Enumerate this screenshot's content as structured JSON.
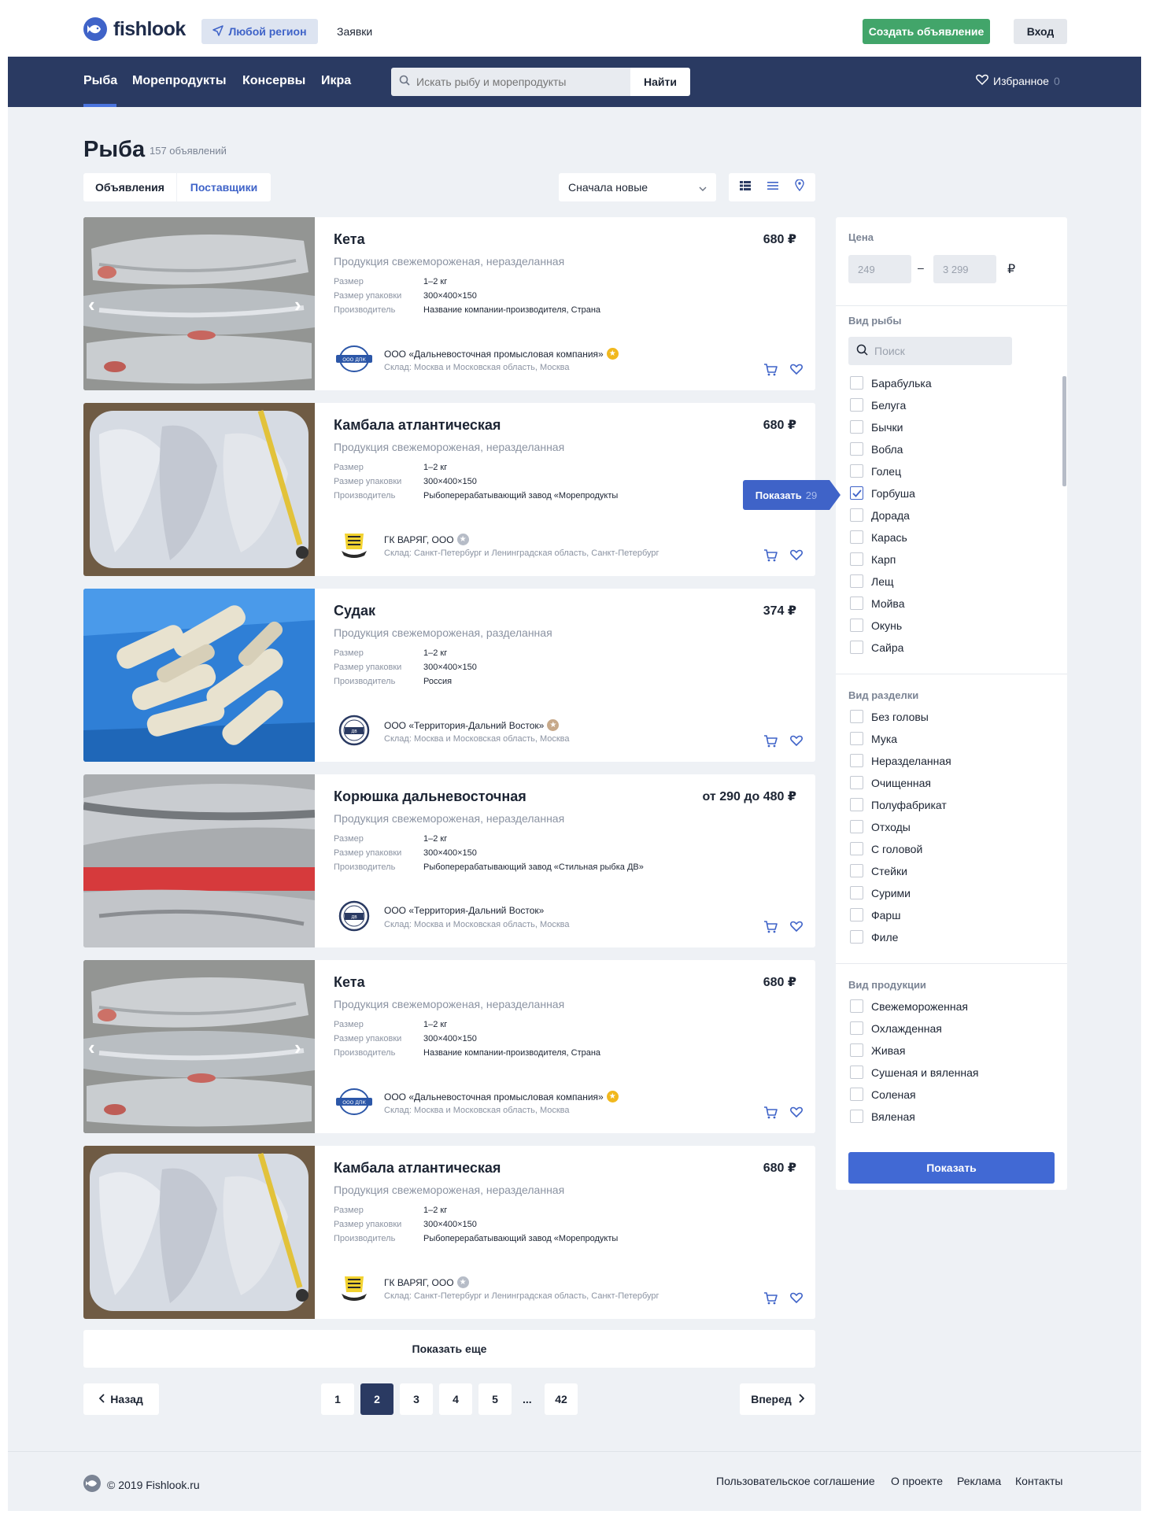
{
  "header": {
    "logo_text": "fishlook",
    "region_label": "Любой регион",
    "requests_label": "Заявки",
    "create_label": "Создать объявление",
    "login_label": "Вход"
  },
  "nav": {
    "items": [
      "Рыба",
      "Морепродукты",
      "Консервы",
      "Икра"
    ],
    "search_placeholder": "Искать рыбу и морепродукты",
    "search_button": "Найти",
    "favorites_label": "Избранное",
    "favorites_count": "0"
  },
  "main": {
    "title": "Рыба",
    "count": "157 объявлений",
    "tabs": [
      "Объявления",
      "Поставщики"
    ],
    "sort_label": "Сначала новые",
    "spec_labels": [
      "Размер",
      "Размер упаковки",
      "Производитель"
    ],
    "listings": [
      {
        "title": "Кета",
        "price": "680 ₽",
        "sub": "Продукция свежемороженая, неразделанная",
        "size": "1–2 кг",
        "pack": "300×400×150",
        "maker": "Название компании-производителя, Страна",
        "seller": "ООО «Дальневосточная промысловая компания»",
        "warehouse": "Склад: Москва и Московская область, Москва",
        "star": "gold",
        "image": "keta",
        "seller_logo": "dpk"
      },
      {
        "title": "Камбала атлантическая",
        "price": "680 ₽",
        "sub": "Продукция свежемороженая, неразделанная",
        "size": "1–2 кг",
        "pack": "300×400×150",
        "maker": "Рыбоперерабатывающий завод «Морепродукты",
        "seller": "ГК ВАРЯГ, ООО",
        "warehouse": "Склад: Санкт-Петербург и Ленинградская область, Санкт-Петербург",
        "star": "grey",
        "image": "kambala",
        "seller_logo": "varyag"
      },
      {
        "title": "Судак",
        "price": "374 ₽",
        "sub": "Продукция свежемороженая, разделанная",
        "size": "1–2 кг",
        "pack": "300×400×150",
        "maker": "Россия",
        "seller": "ООО «Территория-Дальний Восток»",
        "warehouse": "Склад: Москва и Московская область, Москва",
        "star": "grey-dark",
        "image": "sudak",
        "seller_logo": "dv"
      },
      {
        "title": "Корюшка дальневосточная",
        "price": "от 290 до 480 ₽",
        "sub": "Продукция свежемороженая, неразделанная",
        "size": "1–2 кг",
        "pack": "300×400×150",
        "maker": "Рыбоперерабатывающий завод «Стильная рыбка ДВ»",
        "seller": "ООО «Территория-Дальний Восток»",
        "warehouse": "Склад: Москва и Московская область, Москва",
        "star": "none",
        "image": "koryushka",
        "seller_logo": "dv"
      },
      {
        "title": "Кета",
        "price": "680 ₽",
        "sub": "Продукция свежемороженая, неразделанная",
        "size": "1–2 кг",
        "pack": "300×400×150",
        "maker": "Название компании-производителя, Страна",
        "seller": "ООО «Дальневосточная промысловая компания»",
        "warehouse": "Склад: Москва и Московская область, Москва",
        "star": "gold",
        "image": "keta",
        "seller_logo": "dpk"
      },
      {
        "title": "Камбала атлантическая",
        "price": "680 ₽",
        "sub": "Продукция свежемороженая, неразделанная",
        "size": "1–2 кг",
        "pack": "300×400×150",
        "maker": "Рыбоперерабатывающий завод «Морепродукты",
        "seller": "ГК ВАРЯГ, ООО",
        "warehouse": "Склад: Санкт-Петербург и Ленинградская область, Санкт-Петербург",
        "star": "grey",
        "image": "kambala",
        "seller_logo": "varyag"
      }
    ],
    "more_label": "Показать еще",
    "pagination": {
      "back": "Назад",
      "next": "Вперед",
      "pages": [
        "1",
        "2",
        "3",
        "4",
        "5",
        "42"
      ],
      "active": "2",
      "dots": "..."
    }
  },
  "filters": {
    "price_label": "Цена",
    "price_from": "249",
    "price_to": "3 299",
    "currency": "₽",
    "fish_label": "Вид рыбы",
    "fish_search": "Поиск",
    "fish": [
      {
        "label": "Барабулька",
        "checked": false
      },
      {
        "label": "Белуга",
        "checked": false
      },
      {
        "label": "Бычки",
        "checked": false
      },
      {
        "label": "Вобла",
        "checked": false
      },
      {
        "label": "Голец",
        "checked": false
      },
      {
        "label": "Горбуша",
        "checked": true
      },
      {
        "label": "Дорада",
        "checked": false
      },
      {
        "label": "Карась",
        "checked": false
      },
      {
        "label": "Карп",
        "checked": false
      },
      {
        "label": "Лещ",
        "checked": false
      },
      {
        "label": "Мойва",
        "checked": false
      },
      {
        "label": "Окунь",
        "checked": false
      },
      {
        "label": "Сайра",
        "checked": false
      }
    ],
    "cut_label": "Вид разделки",
    "cut": [
      "Без головы",
      "Мука",
      "Неразделанная",
      "Очищенная",
      "Полуфабрикат",
      "Отходы",
      "С головой",
      "Стейки",
      "Сурими",
      "Фарш",
      "Филе"
    ],
    "product_label": "Вид продукции",
    "product": [
      "Свежемороженная",
      "Охлажденная",
      "Живая",
      "Сушеная и вяленная",
      "Соленая",
      "Вяленая"
    ],
    "show_label": "Показать",
    "popup_label": "Показать",
    "popup_count": "29"
  },
  "footer": {
    "copyright": "© 2019 Fishlook.ru",
    "links": [
      "Пользовательское соглашение",
      "О проекте",
      "Реклама",
      "Контакты"
    ]
  },
  "colors": {
    "accent": "#3f63c8",
    "navbar": "#2a3a62",
    "green": "#42a56a",
    "background": "#eef1f5"
  }
}
